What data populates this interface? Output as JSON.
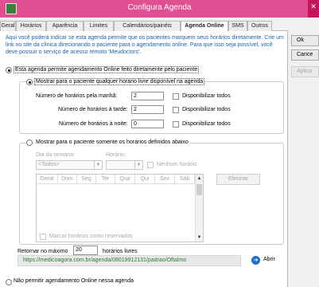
{
  "window": {
    "title": "Configura Agenda",
    "close_glyph": "✕",
    "app_icon": "green-calendar-icon"
  },
  "tabs": [
    "Geral",
    "Horários",
    "Aparência",
    "Limites",
    "Calendários/painéis",
    "Agenda Online",
    "SMS",
    "Outros"
  ],
  "active_tab": "Agenda Online",
  "description": "Aqui você poderá indicar se esta agenda permite que os pacientes marquem seus horários diretamente. Crie um link no site da clínica direcionando o paciente para o agendamento online. Para que isso seja possível, você deve possuir o serviço de acesso remoto 'Meudoctors'.",
  "allow_online": {
    "label": "Esta agenda permite agendamento Online feito diretamente pelo paciente",
    "selected": true,
    "mode_any": {
      "label": "Mostrar para o paciente qualquer horário livre disponível na agenda",
      "selected": true,
      "rows": [
        {
          "label": "Número de horários pela manhã:",
          "value": "2",
          "check_label": "Disponibilizar todos"
        },
        {
          "label": "Número de horários à tarde:",
          "value": "2",
          "check_label": "Disponibilizar todos"
        },
        {
          "label": "Número de horários à noite:",
          "value": "0",
          "check_label": "Disponibilizar todos"
        }
      ]
    },
    "mode_defined": {
      "label": "Mostrar para o paciente somente os horários definidos abaixo",
      "selected": false,
      "weekday_label": "Dia da semana:",
      "weekday_value": "<Todos>",
      "time_label": "Horário:",
      "time_value": "",
      "no_time_label": "Nenhum horário",
      "grid_columns": [
        "Geral",
        "Dom",
        "Seg",
        "Ter",
        "Qua",
        "Qui",
        "Sex",
        "Sáb"
      ],
      "delete_label": "Eliminar",
      "mark_reserved_label": "Marcar horários como reservados"
    },
    "return_max_prefix": "Retornar no máximo",
    "return_max_value": "20",
    "return_max_suffix": "horários livres",
    "url": "https://medicoagora.com.br/agenda/08019912131/padrao/Oftalmo",
    "open_label": "Abrir",
    "open_icon": "globe-arrow-icon"
  },
  "deny_online": {
    "label": "Não permitir agendamento Online nessa agenda",
    "selected": false
  },
  "side_buttons": {
    "ok": "Ok",
    "cancel": "Cance",
    "apply": "Aplica"
  }
}
